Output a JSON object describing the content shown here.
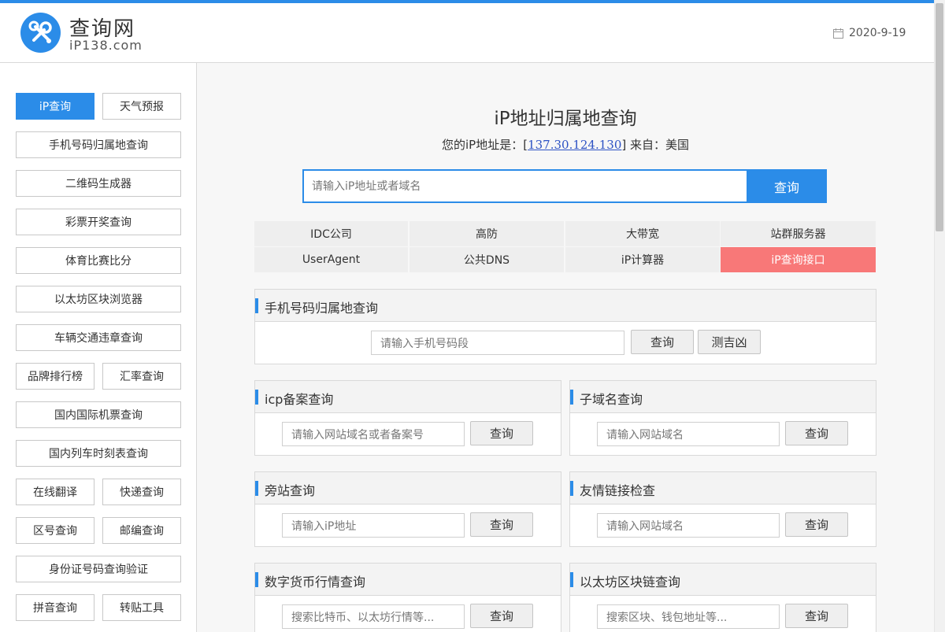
{
  "header": {
    "site_name": "查询网",
    "site_domain": "iP138.com",
    "date": "2020-9-19",
    "logo_icon": "tools-icon",
    "date_icon": "calendar-icon",
    "accent_color": "#2b8ce8"
  },
  "sidebar": {
    "items": [
      "iP查询",
      "天气预报",
      "手机号码归属地查询",
      "二维码生成器",
      "彩票开奖查询",
      "体育比赛比分",
      "以太坊区块浏览器",
      "车辆交通违章查询",
      "品牌排行榜",
      "汇率查询",
      "国内国际机票查询",
      "国内列车时刻表查询",
      "在线翻译",
      "快递查询",
      "区号查询",
      "邮编查询",
      "身份证号码查询验证",
      "拼音查询",
      "转贴工具"
    ]
  },
  "main": {
    "title": "iP地址归属地查询",
    "myip_prefix": "您的iP地址是：[",
    "myip_value": "137.30.124.130",
    "myip_suffix": "] 来自：美国",
    "search_placeholder": "请输入iP地址或者域名",
    "search_button": "查询",
    "links": [
      "IDC公司",
      "高防",
      "大带宽",
      "站群服务器",
      "UserAgent",
      "公共DNS",
      "iP计算器",
      "iP查询接口"
    ],
    "highlight_color": "#f87878"
  },
  "panels": {
    "mobile": {
      "title": "手机号码归属地查询",
      "placeholder": "请输入手机号码段",
      "button": "查询",
      "button2": "测吉凶"
    },
    "icp": {
      "title": "icp备案查询",
      "placeholder": "请输入网站域名或者备案号",
      "button": "查询"
    },
    "subdomain": {
      "title": "子域名查询",
      "placeholder": "请输入网站域名",
      "button": "查询"
    },
    "sidesite": {
      "title": "旁站查询",
      "placeholder": "请输入iP地址",
      "button": "查询"
    },
    "friendlink": {
      "title": "友情链接检查",
      "placeholder": "请输入网站域名",
      "button": "查询"
    },
    "crypto": {
      "title": "数字货币行情查询",
      "placeholder": "搜索比特币、以太坊行情等...",
      "button": "查询"
    },
    "eth": {
      "title": "以太坊区块链查询",
      "placeholder": "搜索区块、钱包地址等...",
      "button": "查询"
    }
  }
}
